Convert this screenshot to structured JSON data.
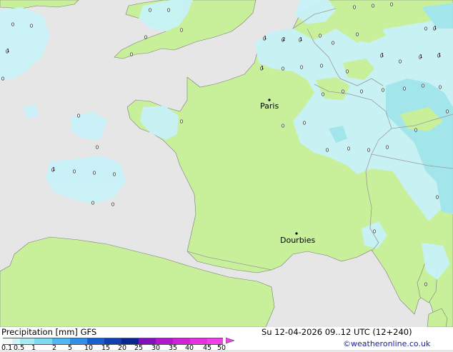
{
  "map": {
    "cities": [
      {
        "name": "Paris"
      },
      {
        "name": "Dourbies"
      }
    ],
    "precip_values": [
      "0",
      "0",
      "1",
      "0",
      "0",
      "0",
      "0",
      "0",
      "0",
      "0",
      "0",
      "0",
      "0",
      "1",
      "1",
      "1",
      "0",
      "1",
      "0",
      "0",
      "0",
      "0",
      "0",
      "1",
      "1",
      "2",
      "1",
      "0",
      "0",
      "0",
      "0",
      "0",
      "0",
      "0",
      "0",
      "0",
      "0",
      "0",
      "0",
      "0",
      "0",
      "0",
      "0",
      "0",
      "1",
      "0",
      "0",
      "0",
      "0",
      "0",
      "0",
      "0",
      "0",
      "0",
      "0",
      "0"
    ],
    "colors": {
      "land": "#c8f09a",
      "sea": "#e6e6e6",
      "precip_light": "#c8f2f8",
      "precip_mid": "#a0e6f0",
      "border": "#9a9a9a",
      "coast": "#7a7a7a"
    }
  },
  "legend": {
    "title": "Precipitation [mm]  GFS",
    "datetime": "Su 12-04-2026 09..12 UTC (12+240)",
    "copyright": "©weatheronline.co.uk",
    "scale_labels": [
      "0.1",
      "0.5",
      "1",
      "2",
      "5",
      "10",
      "15",
      "20",
      "25",
      "30",
      "35",
      "40",
      "45",
      "50"
    ],
    "scale_colors": [
      "#f0fcfc",
      "#d0f4f8",
      "#a8e8f4",
      "#80d8f0",
      "#50b8f0",
      "#3090e8",
      "#1860d0",
      "#1040b0",
      "#082890",
      "#8010c0",
      "#b018d0",
      "#d020d8",
      "#e830e0",
      "#f040e8"
    ]
  }
}
